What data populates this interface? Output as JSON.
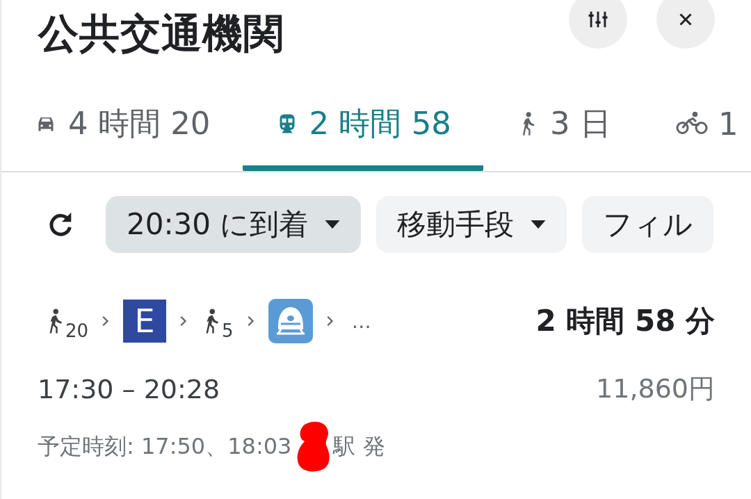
{
  "header": {
    "title": "公共交通機関",
    "buttons": [
      {
        "kind": "options"
      },
      {
        "kind": "close"
      }
    ]
  },
  "tabs": [
    {
      "kind": "car",
      "label": "4 時間 20",
      "selected": false
    },
    {
      "kind": "transit",
      "label": "2 時間 58",
      "selected": true
    },
    {
      "kind": "walk",
      "label": "3 日",
      "selected": false
    },
    {
      "kind": "bike",
      "label": "1",
      "selected": false
    }
  ],
  "chips": [
    {
      "label": "20:30 に到着",
      "dropdown": true,
      "selected": true
    },
    {
      "label": "移動手段",
      "dropdown": true,
      "selected": false
    },
    {
      "label": "フィル",
      "dropdown": false,
      "selected": false
    }
  ],
  "route": {
    "steps": [
      {
        "kind": "walk",
        "minutes": "20"
      },
      {
        "kind": "line",
        "badge": "E"
      },
      {
        "kind": "walk",
        "minutes": "5"
      },
      {
        "kind": "train"
      },
      {
        "kind": "more",
        "text": "…"
      }
    ],
    "duration": "2 時間 58 分",
    "times": "17:30 – 20:28",
    "fare": "11,860円",
    "departure": {
      "before": "予定時刻: 17:50、18:03",
      "redacted": true,
      "after": "駅 発"
    }
  }
}
